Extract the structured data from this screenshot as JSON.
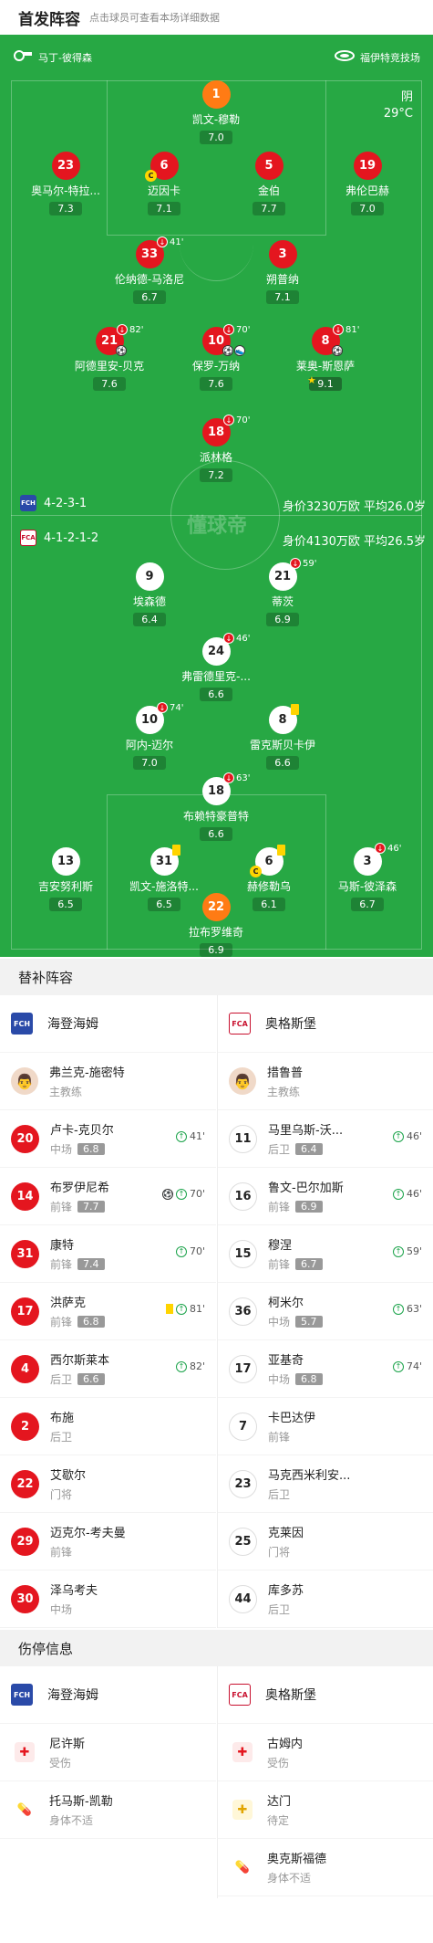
{
  "header": {
    "title": "首发阵容",
    "subtitle": "点击球员可查看本场详细数据"
  },
  "referees": {
    "home": "马丁-彼得森",
    "away": "福伊特竞技场"
  },
  "weather": {
    "condition": "阴",
    "temp": "29°C"
  },
  "home": {
    "formation": "4-2-3-1",
    "value": "身价3230万欧 平均26.0岁",
    "players": [
      {
        "num": "1",
        "name": "凯文-穆勒",
        "rating": "7.0",
        "gk": true
      },
      {
        "num": "23",
        "name": "奥马尔-特拉...",
        "rating": "7.3"
      },
      {
        "num": "6",
        "name": "迈因卡",
        "rating": "7.1"
      },
      {
        "num": "5",
        "name": "金伯",
        "rating": "7.7"
      },
      {
        "num": "19",
        "name": "弗伦巴赫",
        "rating": "7.0"
      },
      {
        "num": "33",
        "name": "伦纳德-马洛尼",
        "rating": "6.7",
        "min": "41'"
      },
      {
        "num": "3",
        "name": "朔普纳",
        "rating": "7.1"
      },
      {
        "num": "21",
        "name": "阿德里安-贝克",
        "rating": "7.6",
        "min": "82'"
      },
      {
        "num": "10",
        "name": "保罗-万纳",
        "rating": "7.6",
        "min": "70'"
      },
      {
        "num": "8",
        "name": "莱奥-斯恩萨",
        "rating": "9.1",
        "min": "81'"
      },
      {
        "num": "18",
        "name": "派林格",
        "rating": "7.2",
        "min": "70'"
      }
    ]
  },
  "away": {
    "formation": "4-1-2-1-2",
    "value": "身价4130万欧 平均26.5岁",
    "players": [
      {
        "num": "9",
        "name": "埃森德",
        "rating": "6.4"
      },
      {
        "num": "21",
        "name": "蒂茨",
        "rating": "6.9",
        "min": "59'"
      },
      {
        "num": "24",
        "name": "弗雷德里克-...",
        "rating": "6.6",
        "min": "46'"
      },
      {
        "num": "10",
        "name": "阿内-迈尔",
        "rating": "7.0",
        "min": "74'"
      },
      {
        "num": "8",
        "name": "雷克斯贝卡伊",
        "rating": "6.6"
      },
      {
        "num": "18",
        "name": "布赖特豪普特",
        "rating": "6.6",
        "min": "63'"
      },
      {
        "num": "13",
        "name": "吉安努利斯",
        "rating": "6.5"
      },
      {
        "num": "31",
        "name": "凯文-施洛特...",
        "rating": "6.5"
      },
      {
        "num": "6",
        "name": "赫修勒乌",
        "rating": "6.1"
      },
      {
        "num": "3",
        "name": "马斯-彼泽森",
        "rating": "6.7",
        "min": "46'"
      },
      {
        "num": "22",
        "name": "拉布罗维奇",
        "rating": "6.9",
        "gk": true
      }
    ]
  },
  "watermark": "懂球帝",
  "subs": {
    "title": "替补阵容",
    "home_team": "海登海姆",
    "away_team": "奥格斯堡",
    "home_coach": {
      "name": "弗兰克-施密特",
      "role": "主教练"
    },
    "away_coach": {
      "name": "措鲁普",
      "role": "主教练"
    },
    "home": [
      {
        "num": "20",
        "name": "卢卡-克贝尔",
        "pos": "中场",
        "rating": "6.8",
        "min": "41'"
      },
      {
        "num": "14",
        "name": "布罗伊尼希",
        "pos": "前锋",
        "rating": "7.7",
        "min": "70'",
        "ball": true
      },
      {
        "num": "31",
        "name": "康特",
        "pos": "前锋",
        "rating": "7.4",
        "min": "70'"
      },
      {
        "num": "17",
        "name": "洪萨克",
        "pos": "前锋",
        "rating": "6.8",
        "min": "81'",
        "yellow": true
      },
      {
        "num": "4",
        "name": "西尔斯莱本",
        "pos": "后卫",
        "rating": "6.6",
        "min": "82'"
      },
      {
        "num": "2",
        "name": "布施",
        "pos": "后卫"
      },
      {
        "num": "22",
        "name": "艾歇尔",
        "pos": "门将"
      },
      {
        "num": "29",
        "name": "迈克尔-考夫曼",
        "pos": "前锋"
      },
      {
        "num": "30",
        "name": "泽乌考夫",
        "pos": "中场"
      }
    ],
    "away": [
      {
        "num": "11",
        "name": "马里乌斯-沃...",
        "pos": "后卫",
        "rating": "6.4",
        "min": "46'"
      },
      {
        "num": "16",
        "name": "鲁文-巴尔加斯",
        "pos": "前锋",
        "rating": "6.9",
        "min": "46'"
      },
      {
        "num": "15",
        "name": "穆涅",
        "pos": "前锋",
        "rating": "6.7",
        "min": "59'"
      },
      {
        "num": "36",
        "name": "柯米尔",
        "pos": "中场",
        "rating": "5.7",
        "min": "63'"
      },
      {
        "num": "17",
        "name": "亚基奇",
        "pos": "中场",
        "rating": "6.8",
        "min": "74'"
      },
      {
        "num": "7",
        "name": "卡巴达伊",
        "pos": "前锋"
      },
      {
        "num": "23",
        "name": "马克西米利安...",
        "pos": "后卫"
      },
      {
        "num": "25",
        "name": "克莱因",
        "pos": "门将"
      },
      {
        "num": "44",
        "name": "库多苏",
        "pos": "后卫"
      }
    ]
  },
  "injuries": {
    "title": "伤停信息",
    "home_team": "海登海姆",
    "away_team": "奥格斯堡",
    "home": [
      {
        "name": "尼许斯",
        "status": "受伤",
        "icon": "medical-kit"
      },
      {
        "name": "托马斯-凯勒",
        "status": "身体不适",
        "icon": "pill"
      }
    ],
    "away": [
      {
        "name": "古姆内",
        "status": "受伤",
        "icon": "medical-kit"
      },
      {
        "name": "达门",
        "status": "待定",
        "icon": "medical-box"
      },
      {
        "name": "奥克斯福德",
        "status": "身体不适",
        "icon": "pill"
      }
    ]
  }
}
